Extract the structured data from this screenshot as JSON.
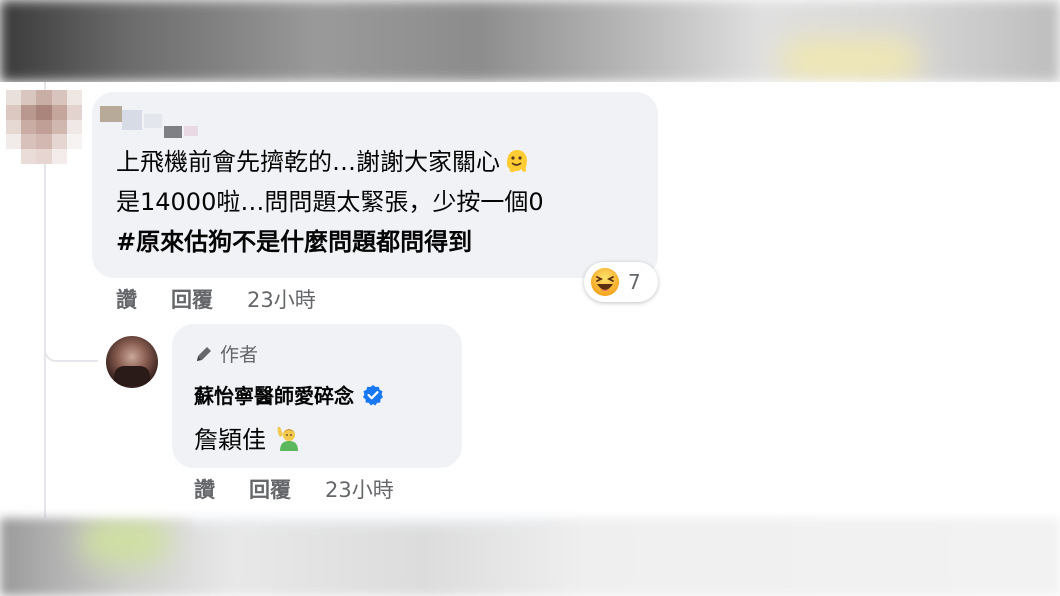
{
  "comment": {
    "lines": [
      "上飛機前會先擠乾的…謝謝大家關心",
      "是14000啦…問問題太緊張，少按一個0",
      "#原來估狗不是什麼問題都問得到"
    ],
    "actions": {
      "like": "讚",
      "reply": "回覆",
      "time": "23小時"
    },
    "reactions": {
      "icon": "laughing-emoji-icon",
      "count": "7"
    }
  },
  "reply": {
    "author_badge": "作者",
    "name": "蘇怡寧醫師愛碎念",
    "text": "詹穎佳",
    "actions": {
      "like": "讚",
      "reply": "回覆",
      "time": "23小時"
    }
  },
  "colors": {
    "bubble": "#f0f2f5",
    "meta_text": "#65676b",
    "verified": "#1877f2",
    "text": "#050505"
  }
}
